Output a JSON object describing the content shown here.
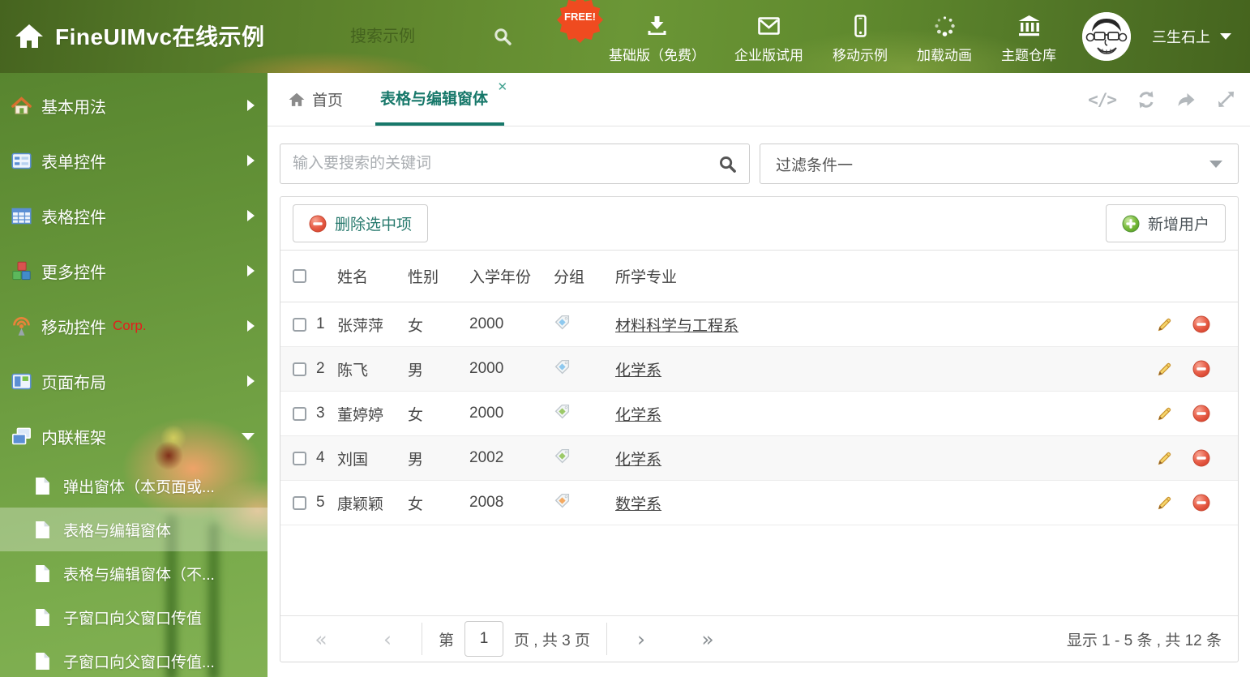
{
  "header": {
    "title": "FineUIMvc在线示例",
    "search_placeholder": "搜索示例",
    "free_badge": "FREE!",
    "nav_items": [
      {
        "icon": "download-icon",
        "label": "基础版（免费）"
      },
      {
        "icon": "envelope-icon",
        "label": "企业版试用"
      },
      {
        "icon": "mobile-icon",
        "label": "移动示例"
      },
      {
        "icon": "spinner-icon",
        "label": "加载动画"
      },
      {
        "icon": "bank-icon",
        "label": "主题仓库"
      }
    ],
    "user": {
      "name": "三生石上"
    }
  },
  "sidebar": {
    "items": [
      {
        "label": "基本用法"
      },
      {
        "label": "表单控件"
      },
      {
        "label": "表格控件"
      },
      {
        "label": "更多控件"
      },
      {
        "label": "移动控件",
        "badge": "Corp."
      },
      {
        "label": "页面布局"
      },
      {
        "label": "内联框架"
      }
    ],
    "subitems": [
      {
        "label": "弹出窗体（本页面或..."
      },
      {
        "label": "表格与编辑窗体",
        "selected": true
      },
      {
        "label": "表格与编辑窗体（不..."
      },
      {
        "label": "子窗口向父窗口传值"
      },
      {
        "label": "子窗口向父窗口传值..."
      }
    ]
  },
  "tabs": {
    "home": "首页",
    "active": "表格与编辑窗体",
    "close": "✕"
  },
  "filters": {
    "search_placeholder": "输入要搜索的关键词",
    "filter_value": "过滤条件一"
  },
  "grid": {
    "delete_button": "删除选中项",
    "add_button": "新增用户",
    "columns": {
      "name": "姓名",
      "gender": "性别",
      "year": "入学年份",
      "group": "分组",
      "major": "所学专业"
    },
    "rows": [
      {
        "num": "1",
        "name": "张萍萍",
        "gender": "女",
        "year": "2000",
        "tag_color": "#8ec9ef",
        "major": "材料科学与工程系"
      },
      {
        "num": "2",
        "name": "陈飞",
        "gender": "男",
        "year": "2000",
        "tag_color": "#8ec9ef",
        "major": "化学系"
      },
      {
        "num": "3",
        "name": "董婷婷",
        "gender": "女",
        "year": "2000",
        "tag_color": "#9cc968",
        "major": "化学系"
      },
      {
        "num": "4",
        "name": "刘国",
        "gender": "男",
        "year": "2002",
        "tag_color": "#9cc968",
        "major": "化学系"
      },
      {
        "num": "5",
        "name": "康颖颖",
        "gender": "女",
        "year": "2008",
        "tag_color": "#f4aa62",
        "major": "数学系"
      }
    ],
    "pagination": {
      "first": "«",
      "prev": "‹",
      "next": "›",
      "last": "»",
      "prefix": "第",
      "page": "1",
      "suffix": "页 , 共 3 页",
      "summary": "显示 1 - 5 条 , 共 12 条"
    }
  },
  "colors": {
    "accent_teal": "#17786a",
    "header_green": "#6b9636",
    "corp_red": "#e51c1c",
    "free_badge_bg": "#ef4b20"
  }
}
